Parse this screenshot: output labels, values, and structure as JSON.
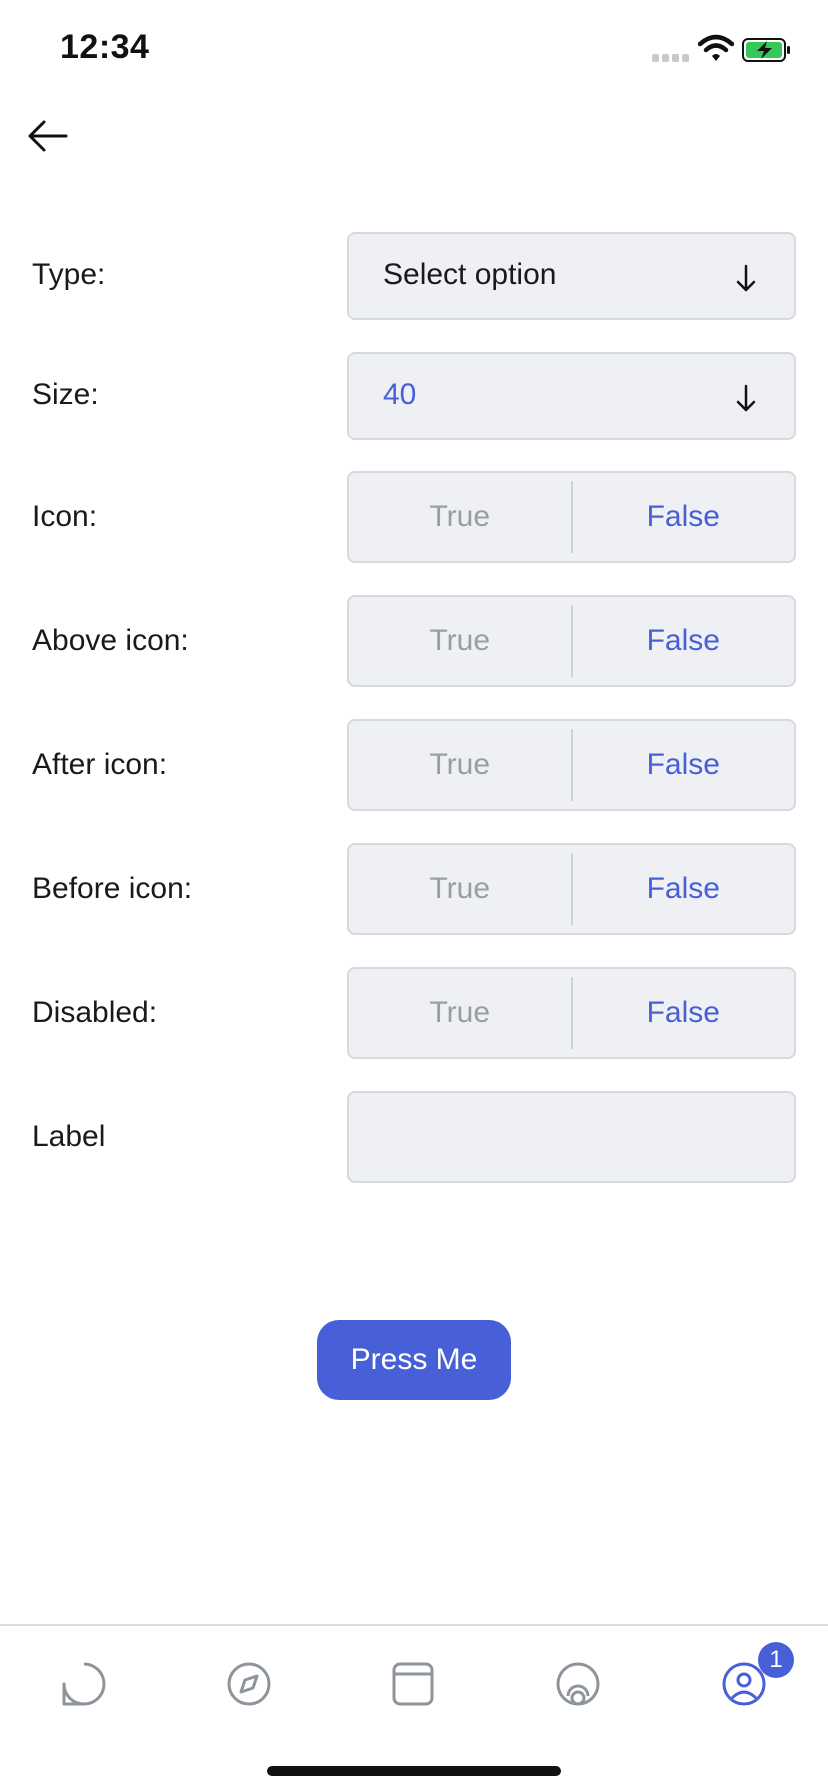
{
  "status_bar": {
    "time": "12:34"
  },
  "form": {
    "type": {
      "label": "Type:",
      "value": "Select option"
    },
    "size": {
      "label": "Size:",
      "value": "40"
    },
    "toggles": [
      {
        "label": "Icon:",
        "true_label": "True",
        "false_label": "False",
        "selected": "False"
      },
      {
        "label": "Above icon:",
        "true_label": "True",
        "false_label": "False",
        "selected": "False"
      },
      {
        "label": "After icon:",
        "true_label": "True",
        "false_label": "False",
        "selected": "False"
      },
      {
        "label": "Before icon:",
        "true_label": "True",
        "false_label": "False",
        "selected": "False"
      },
      {
        "label": "Disabled:",
        "true_label": "True",
        "false_label": "False",
        "selected": "False"
      }
    ],
    "label_field": {
      "label": "Label",
      "value": ""
    }
  },
  "action": {
    "button_label": "Press Me"
  },
  "tab_bar": {
    "tabs": [
      {
        "icon": "chat-bubble-icon"
      },
      {
        "icon": "compass-icon"
      },
      {
        "icon": "browser-window-icon"
      },
      {
        "icon": "radio-podcast-icon"
      },
      {
        "icon": "profile-icon"
      }
    ],
    "badge_count": "1"
  },
  "colors": {
    "accent": "#4760d8",
    "field_bg": "#eef0f3",
    "muted_text": "#9a9ea4",
    "battery_green": "#34c759"
  }
}
